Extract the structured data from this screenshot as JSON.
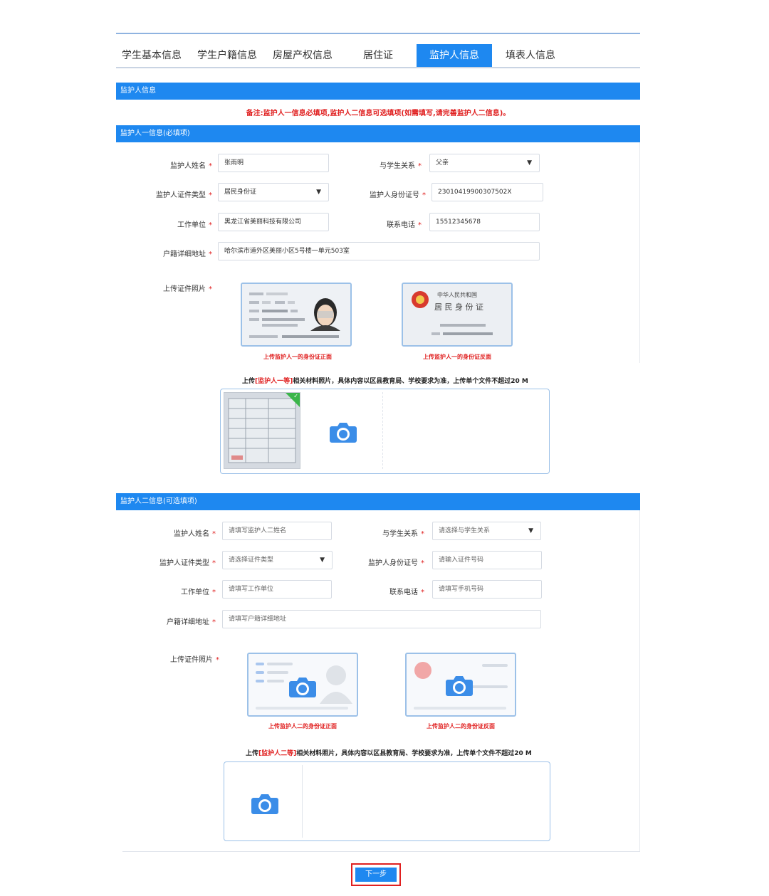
{
  "tabs": [
    {
      "label": "学生基本信息",
      "active": false
    },
    {
      "label": "学生户籍信息",
      "active": false
    },
    {
      "label": "房屋产权信息",
      "active": false
    },
    {
      "label": "居住证",
      "active": false
    },
    {
      "label": "监护人信息",
      "active": true
    },
    {
      "label": "填表人信息",
      "active": false
    }
  ],
  "section_title": "监护人信息",
  "note": "备注:监护人一信息必填项,监护人二信息可选填项(如需填写,请完善监护人二信息)。",
  "guardian1": {
    "title": "监护人一信息(必填项)",
    "name_label": "监护人姓名",
    "name_value": "张雨明",
    "relation_label": "与学生关系",
    "relation_value": "父亲",
    "idtype_label": "监护人证件类型",
    "idtype_value": "居民身份证",
    "idno_label": "监护人身份证号",
    "idno_value": "23010419900307502X",
    "work_label": "工作单位",
    "work_value": "黑龙江省美丽科技有限公司",
    "phone_label": "联系电话",
    "phone_value": "15512345678",
    "addr_label": "户籍详细地址",
    "addr_value": "哈尔滨市道外区美丽小区5号楼一单元503室",
    "photo_label": "上传证件照片",
    "front_caption": "上传监护人一的身份证正面",
    "back_caption": "上传监护人一的身份证反面",
    "card_back_line1": "中华人民共和国",
    "card_back_line2": "居 民 身 份 证",
    "upload_prefix": "上传",
    "upload_highlight": "[监护人一等]",
    "upload_suffix": "相关材料照片，具体内容以区县教育局、学校要求为准，上传单个文件不超过20 M"
  },
  "guardian2": {
    "title": "监护人二信息(可选填项)",
    "name_label": "监护人姓名",
    "name_placeholder": "请填写监护人二姓名",
    "relation_label": "与学生关系",
    "relation_placeholder": "请选择与学生关系",
    "idtype_label": "监护人证件类型",
    "idtype_placeholder": "请选择证件类型",
    "idno_label": "监护人身份证号",
    "idno_placeholder": "请输入证件号码",
    "work_label": "工作单位",
    "work_placeholder": "请填写工作单位",
    "phone_label": "联系电话",
    "phone_placeholder": "请填写手机号码",
    "addr_label": "户籍详细地址",
    "addr_placeholder": "请填写户籍详细地址",
    "photo_label": "上传证件照片",
    "front_caption": "上传监护人二的身份证正面",
    "back_caption": "上传监护人二的身份证反面",
    "upload_prefix": "上传",
    "upload_highlight": "[监护人二等]",
    "upload_suffix": "相关材料照片，具体内容以区县教育局、学校要求为准，上传单个文件不超过20 M"
  },
  "next_button": "下一步",
  "colors": {
    "primary": "#1e88f0",
    "required": "#e02020",
    "card_border": "#9cc1e8"
  },
  "icons": [
    "camera-icon",
    "dropdown-caret-icon",
    "check-icon",
    "national-emblem-icon",
    "avatar-placeholder-icon"
  ]
}
